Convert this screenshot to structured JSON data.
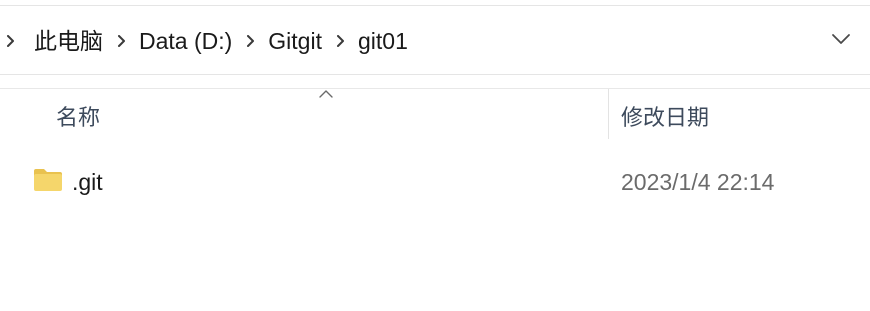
{
  "address_bar": {
    "breadcrumbs": [
      {
        "label": "此电脑"
      },
      {
        "label": "Data (D:)"
      },
      {
        "label": "Gitgit"
      },
      {
        "label": "git01"
      }
    ],
    "icons": {
      "separator": "chevron-right-icon",
      "history_dropdown": "chevron-down-icon"
    }
  },
  "columns": {
    "name_label": "名称",
    "date_label": "修改日期",
    "sort_indicator": "sort-ascending-icon"
  },
  "files": [
    {
      "name": ".git",
      "modified": "2023/1/4 22:14",
      "icon": "folder-icon"
    }
  ],
  "colors": {
    "folder_fill": "#f5d66b",
    "folder_tab": "#e9c24f",
    "header_text": "#3d4a5c",
    "date_text": "#6b6b6b",
    "divider": "#e5e5e5"
  }
}
